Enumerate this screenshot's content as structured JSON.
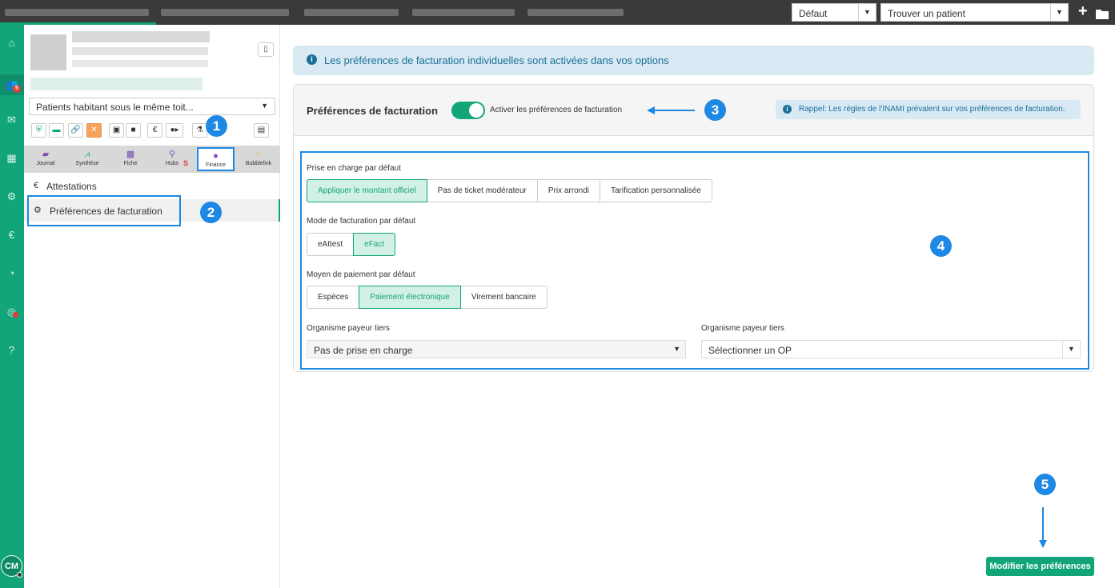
{
  "topbar": {
    "profile_select": "Défaut",
    "patient_search_placeholder": "Trouver un patient",
    "add_icon": "plus-icon",
    "folder_icon": "folder-icon"
  },
  "rail": {
    "icons": [
      "home-icon",
      "users-icon",
      "mail-icon",
      "calendar-icon",
      "settings-icon",
      "euro-icon",
      "chart-pie-icon",
      "broadcast-icon",
      "help-icon"
    ],
    "mail_badge": "5",
    "avatar_initials": "CM"
  },
  "patient_panel": {
    "household_select": "Patients habitant sous le même toit...",
    "tabs": [
      {
        "label": "Journal",
        "icon": "folder-icon"
      },
      {
        "label": "Synthèse",
        "icon": "trend-chart-icon"
      },
      {
        "label": "Fiche",
        "icon": "id-card-icon"
      },
      {
        "label": "Hubs",
        "icon": "network-icon",
        "suffix": "S"
      },
      {
        "label": "Finance",
        "icon": "finance-icon"
      },
      {
        "label": "Bubblelink",
        "icon": "bubblelink-icon"
      }
    ],
    "menu": {
      "attestations": "Attestations",
      "billing_prefs": "Préférences de facturation"
    }
  },
  "annotations": [
    "1",
    "2",
    "3",
    "4",
    "5"
  ],
  "main": {
    "banner": "Les préférences de facturation individuelles sont activées dans vos options",
    "card": {
      "title": "Préférences de facturation",
      "toggle_label": "Activer les préférences de facturation",
      "toggle_on": true,
      "reminder": "Rappel: Les règles de l'INAMI prévalent sur vos préférences de facturation."
    },
    "coverage": {
      "label": "Prise en charge par défaut",
      "options": [
        "Appliquer le montant officiel",
        "Pas de ticket modérateur",
        "Prix arrondi",
        "Tarification personnalisée"
      ],
      "selected": "Appliquer le montant officiel"
    },
    "billing_mode": {
      "label": "Mode de facturation par défaut",
      "options": [
        "eAttest",
        "eFact"
      ],
      "selected": "eFact"
    },
    "payment": {
      "label": "Moyen de paiement par défaut",
      "options": [
        "Espèces",
        "Paiement électronique",
        "Virement bancaire"
      ],
      "selected": "Paiement électronique"
    },
    "third_party_left": {
      "label": "Organisme payeur tiers",
      "value": "Pas de prise en charge"
    },
    "third_party_right": {
      "label": "Organisme payeur tiers",
      "value": "Sélectionner un OP"
    },
    "submit": "Modifier les préférences"
  },
  "colors": {
    "brand": "#12a579",
    "annotation": "#1e88e5",
    "info_bg": "#d8e9f3"
  }
}
